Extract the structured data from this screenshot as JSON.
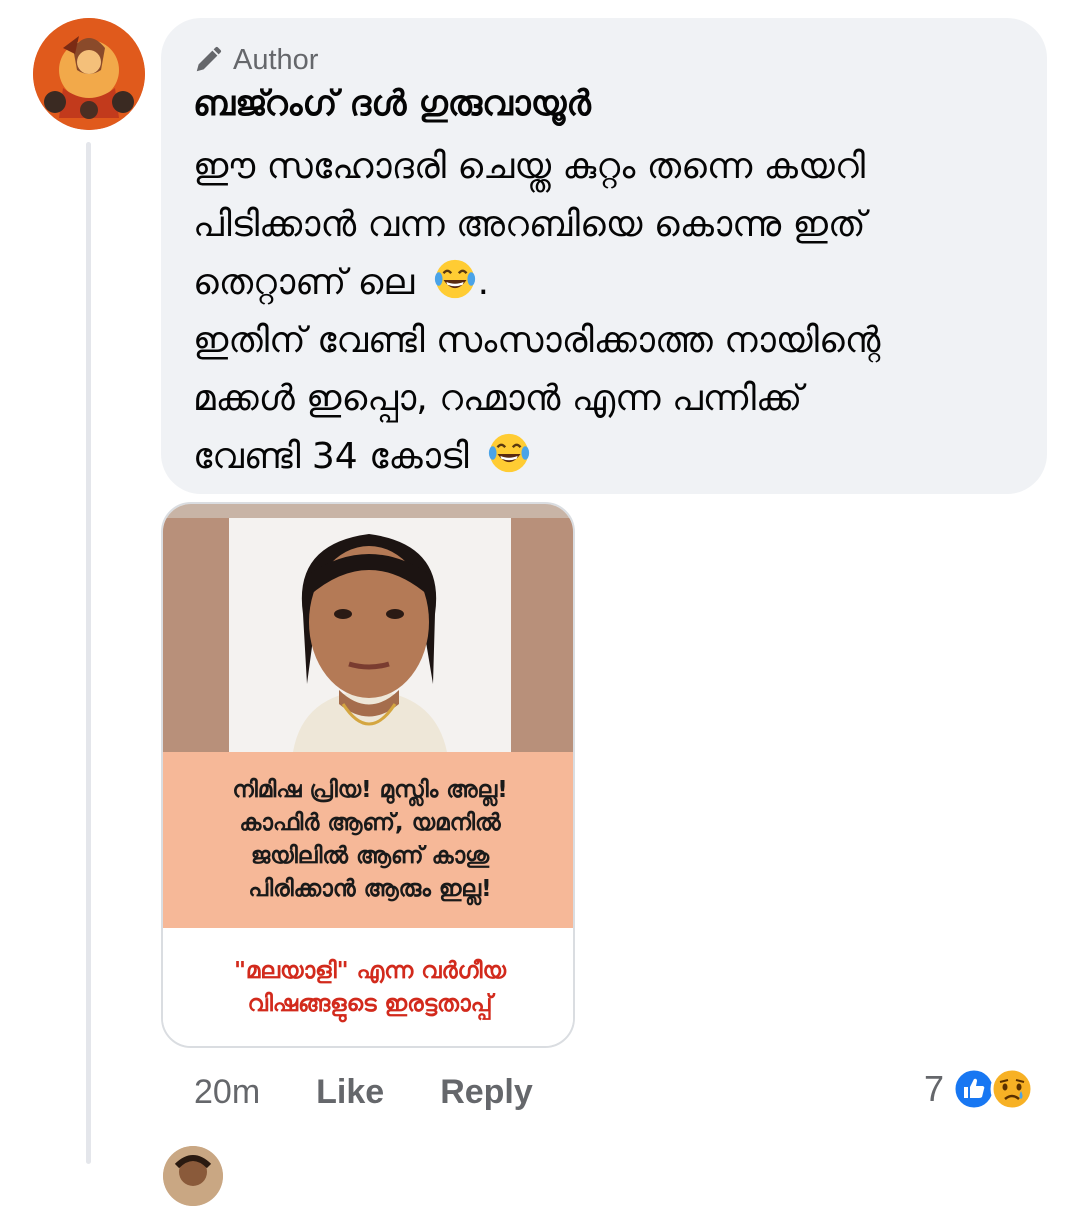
{
  "comment": {
    "author_badge": "Author",
    "commenter_name": "ബജ്റംഗ് ദൾ ഗുരുവായൂർ",
    "text_lines": [
      "ഈ സഹോദരി ചെയ്ത കുറ്റം തന്നെ കയറി",
      "പിടിക്കാൻ വന്ന അറബിയെ കൊന്നു  ഇത്",
      "തെറ്റാണ് ലെ",
      "ഇതിന് വേണ്ടി സംസാരിക്കാത്ത നായിന്റെ",
      "മക്കൾ ഇപ്പൊ, റഹ്മാൻ എന്ന പന്നിക്ക്",
      "വേണ്ടി 34 കോടി"
    ],
    "line3_suffix": ".",
    "emoji_name": "laughing-tears-emoji"
  },
  "image_post": {
    "caption_top_lines": [
      "നിമിഷ പ്രിയ! മുസ്ലിം അല്ല!",
      "കാഫിർ ആണ്, യമനിൽ",
      "ജയിലിൽ ആണ് കാശു",
      "പിരിക്കാൻ ആരും ഇല്ല!"
    ],
    "caption_bottom_lines": [
      "\"മലയാളി\" എന്ന വർഗീയ",
      "വിഷങ്ങളുടെ ഇരട്ടതാപ്പ്"
    ],
    "colors": {
      "caption_top_bg": "#f6b898",
      "caption_bottom_text": "#d22a1c"
    }
  },
  "actions": {
    "time": "20m",
    "like_label": "Like",
    "reply_label": "Reply"
  },
  "reactions": {
    "count": "7",
    "icons": [
      "like-reaction-icon",
      "sad-reaction-icon"
    ],
    "like_color": "#1877f2"
  }
}
